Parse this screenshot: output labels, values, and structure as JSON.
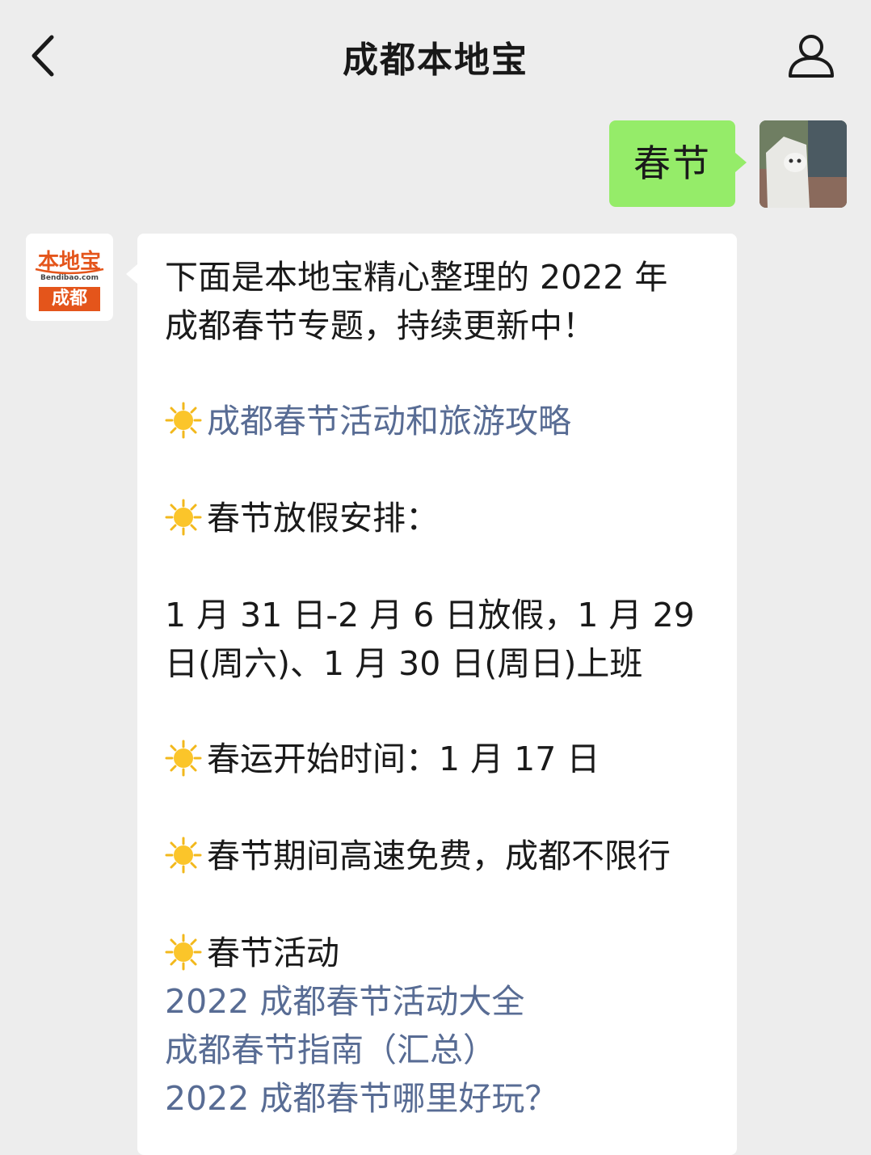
{
  "header": {
    "title": "成都本地宝"
  },
  "chat": {
    "outgoing_text": "春节",
    "bot_logo": {
      "top": "本地宝",
      "url": "Bendibao.com",
      "city": "成都"
    },
    "intro_1": "下面是本地宝精心整理的 2022 年",
    "intro_2": "成都春节专题，持续更新中！",
    "link_guide": "成都春节活动和旅游攻略",
    "holiday_title": "春节放假安排：",
    "holiday_1": "1 月 31 日-2 月 6 日放假，1 月 29",
    "holiday_2": "日(周六)、1 月 30 日(周日)上班",
    "chunyun": "春运开始时间：1 月 17 日",
    "highway": "春节期间高速免费，成都不限行",
    "activity_title": "春节活动",
    "link_1": "2022 成都春节活动大全",
    "link_2": "成都春节指南（汇总）",
    "link_3": "2022 成都春节哪里好玩？"
  },
  "colors": {
    "background": "#ededed",
    "bubble_out": "#95ec69",
    "link": "#586c94",
    "brand": "#e4551b"
  }
}
